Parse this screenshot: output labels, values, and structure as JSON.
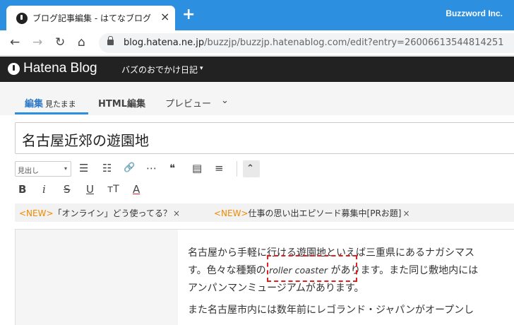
{
  "browser": {
    "tab_title": "ブログ記事編集 - はてなブログ",
    "tab_close": "×",
    "new_tab": "+",
    "window_label": "Buzzword Inc.",
    "url_host": "blog.hatena.ne.jp",
    "url_path": "/buzzjp/buzzjp.hatenablog.com/edit?entry=26006613544814251",
    "nav": {
      "back": "←",
      "forward": "→",
      "reload": "↻",
      "home": "⌂"
    }
  },
  "blog_header": {
    "brand": "Hatena Blog",
    "blog_name": "バズのおでかけ日記",
    "caret": "▾"
  },
  "editor_tabs": {
    "edit": {
      "label": "編集",
      "sub": "見たまま"
    },
    "html": {
      "label": "HTML編集"
    },
    "preview": {
      "label": "プレビュー",
      "caret": "⌄"
    }
  },
  "title_field": {
    "value": "名古屋近郊の遊園地"
  },
  "format_toolbar": {
    "heading_select": "見出し",
    "select_caret": "▾",
    "icons": {
      "bullet_list": "☰",
      "numbered_list": "☷",
      "link": "🔗",
      "more": "⋯",
      "quote": "❝",
      "table": "▤",
      "footnote": "≡",
      "collapse": "⌃",
      "bold": "B",
      "italic": "i",
      "strike": "S",
      "underline": "U",
      "font_size": "тT",
      "text_color": "A"
    }
  },
  "notices": [
    {
      "tag": "<NEW>",
      "text": "「オンライン」どう使ってる？",
      "close": "×"
    },
    {
      "tag": "<NEW>",
      "text": "仕事の思い出エピソード募集中[PRお題]",
      "close": "×"
    }
  ],
  "body": {
    "line1": "名古屋から手軽に行ける遊園地といえば三重県にあるナガシマス",
    "line2_before": "す。色々な種類の ",
    "line2_italic": "roller coaster",
    "line2_after": " があります。また同じ敷地内には",
    "line3": "アンパンマンミュージアムがあります。",
    "line4": "また名古屋市内には数年前にレゴランド・ジャパンがオープンし"
  }
}
